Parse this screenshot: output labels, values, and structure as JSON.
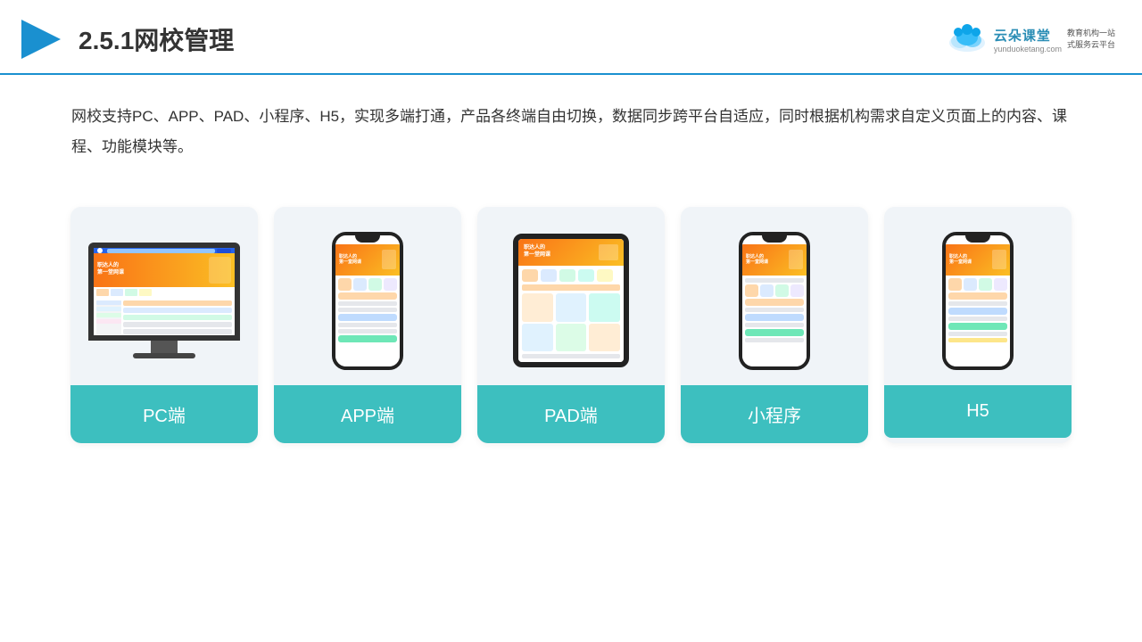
{
  "header": {
    "section_number": "2.5.1",
    "title": "网校管理",
    "brand": {
      "name": "云朵课堂",
      "url": "yunduoketang.com",
      "slogan": "教育机构一站\n式服务云平台"
    }
  },
  "description": {
    "text": "网校支持PC、APP、PAD、小程序、H5，实现多端打通，产品各终端自由切换，数据同步跨平台自适应，同时根据机构需求自定义页面上的内容、课程、功能模块等。"
  },
  "devices": [
    {
      "id": "pc",
      "label": "PC端",
      "type": "monitor"
    },
    {
      "id": "app",
      "label": "APP端",
      "type": "phone"
    },
    {
      "id": "pad",
      "label": "PAD端",
      "type": "tablet"
    },
    {
      "id": "miniprogram",
      "label": "小程序",
      "type": "phone"
    },
    {
      "id": "h5",
      "label": "H5",
      "type": "phone"
    }
  ],
  "colors": {
    "accent": "#3dbfbf",
    "header_border": "#1a90d0",
    "title": "#333333",
    "card_bg": "#f0f4f8"
  }
}
